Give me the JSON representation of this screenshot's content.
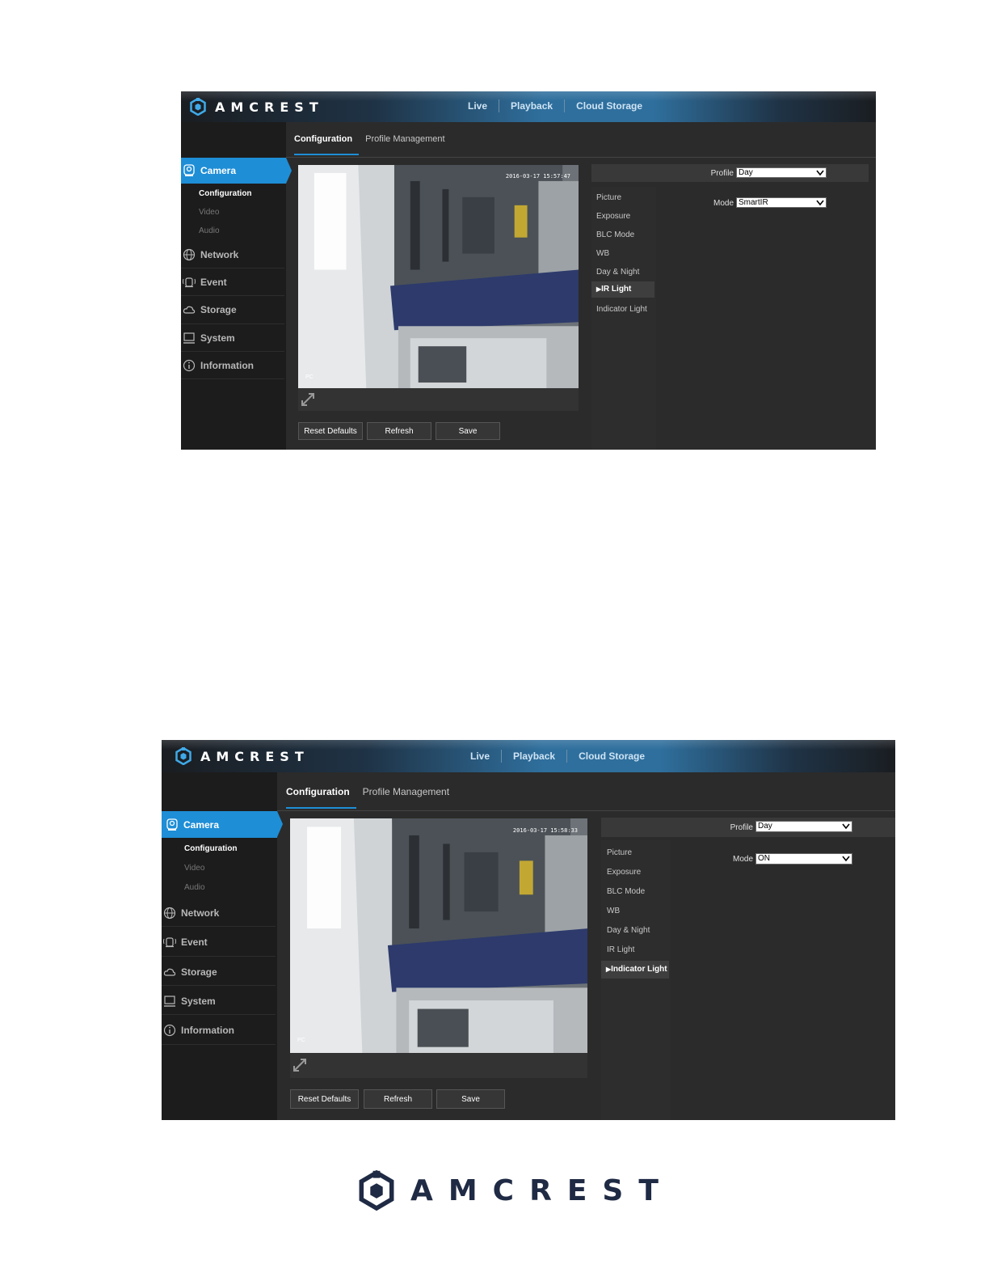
{
  "brand": {
    "name": "AMCREST"
  },
  "colors": {
    "accent": "#1e8ed6",
    "background": "#2b2b2b",
    "sidebar": "#1c1c1c",
    "footer_logo": "#1f2a44"
  },
  "screens": [
    {
      "topnav": [
        "Live",
        "Playback",
        "Cloud Storage"
      ],
      "tabs": [
        "Configuration",
        "Profile Management"
      ],
      "active_tab": "Configuration",
      "sidebar": {
        "active": "Camera",
        "camera_sub": [
          "Configuration",
          "Video",
          "Audio"
        ],
        "items": [
          {
            "label": "Camera",
            "icon": "camera-icon"
          },
          {
            "label": "Network",
            "icon": "globe-icon"
          },
          {
            "label": "Event",
            "icon": "bell-icon"
          },
          {
            "label": "Storage",
            "icon": "cloud-icon"
          },
          {
            "label": "System",
            "icon": "monitor-icon"
          },
          {
            "label": "Information",
            "icon": "info-icon"
          }
        ]
      },
      "video": {
        "timestamp": "2016-03-17 15:57:47",
        "label": "PC"
      },
      "menu": [
        "Picture",
        "Exposure",
        "BLC Mode",
        "WB",
        "Day & Night",
        "IR Light",
        "Indicator Light"
      ],
      "active_menu": "IR Light",
      "profile_label": "Profile",
      "profile_value": "Day",
      "mode_label": "Mode",
      "mode_value": "SmartIR",
      "buttons": [
        "Reset Defaults",
        "Refresh",
        "Save"
      ]
    },
    {
      "topnav": [
        "Live",
        "Playback",
        "Cloud Storage"
      ],
      "tabs": [
        "Configuration",
        "Profile Management"
      ],
      "active_tab": "Configuration",
      "sidebar": {
        "active": "Camera",
        "camera_sub": [
          "Configuration",
          "Video",
          "Audio"
        ],
        "items": [
          {
            "label": "Camera",
            "icon": "camera-icon"
          },
          {
            "label": "Network",
            "icon": "globe-icon"
          },
          {
            "label": "Event",
            "icon": "bell-icon"
          },
          {
            "label": "Storage",
            "icon": "cloud-icon"
          },
          {
            "label": "System",
            "icon": "monitor-icon"
          },
          {
            "label": "Information",
            "icon": "info-icon"
          }
        ]
      },
      "video": {
        "timestamp": "2016-03-17 15:58:33",
        "label": "PC"
      },
      "menu": [
        "Picture",
        "Exposure",
        "BLC Mode",
        "WB",
        "Day & Night",
        "IR Light",
        "Indicator Light"
      ],
      "active_menu": "Indicator Light",
      "profile_label": "Profile",
      "profile_value": "Day",
      "mode_label": "Mode",
      "mode_value": "ON",
      "buttons": [
        "Reset Defaults",
        "Refresh",
        "Save"
      ]
    }
  ],
  "footer": {
    "brand": "AMCREST"
  }
}
